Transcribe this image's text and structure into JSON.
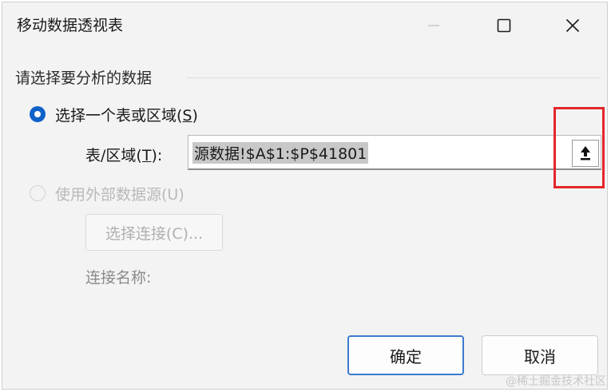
{
  "window": {
    "title": "移动数据透视表"
  },
  "group": {
    "label": "请选择要分析的数据"
  },
  "options": {
    "select_range": {
      "prefix": "选择一个表或区域(",
      "key": "S",
      "suffix": ")",
      "selected": true
    },
    "external": {
      "label": "使用外部数据源(U)",
      "selected": false,
      "enabled": false
    }
  },
  "range_field": {
    "label_prefix": "表/区域(",
    "label_key": "T",
    "label_suffix": "):",
    "value": "源数据!$A$1:$P$41801"
  },
  "connection": {
    "button_label": "选择连接(C)...",
    "name_label": "连接名称:"
  },
  "buttons": {
    "ok": "确定",
    "cancel": "取消"
  },
  "watermark": "@稀土掘金技术社区",
  "colors": {
    "accent": "#0f62c9",
    "highlight_border": "#e3262a"
  },
  "icons": {
    "collapse": "collapse-dialog-icon",
    "minimize": "minimize-icon",
    "maximize": "maximize-icon",
    "close": "close-icon"
  }
}
